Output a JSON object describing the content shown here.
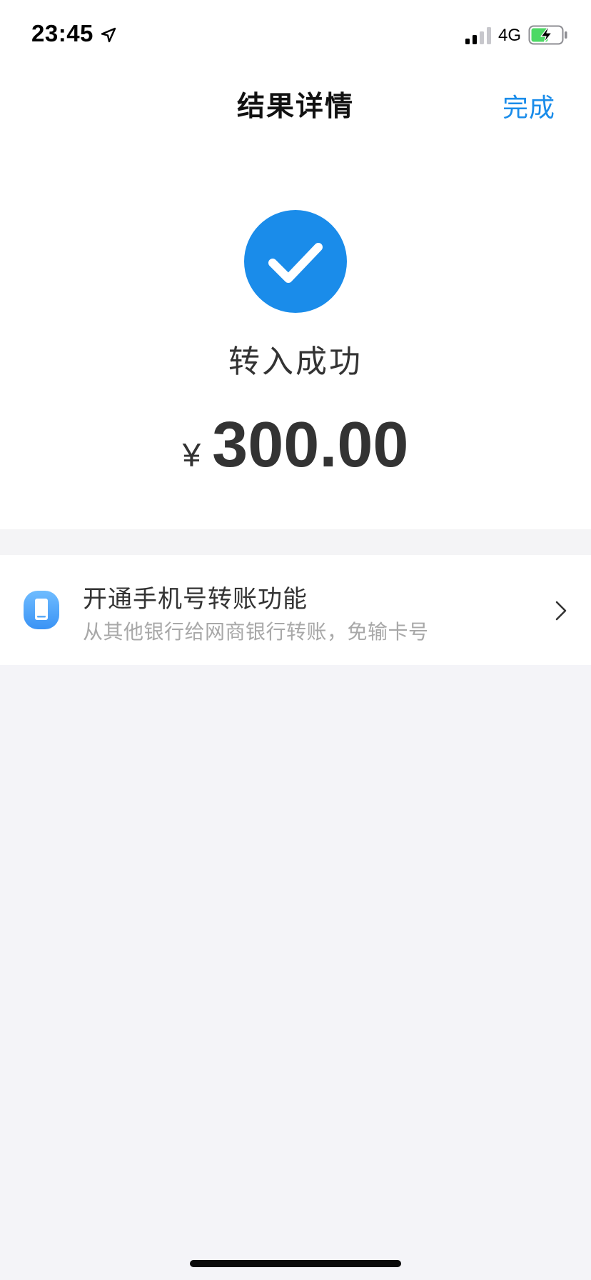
{
  "status_bar": {
    "time": "23:45",
    "network": "4G",
    "icons": {
      "location": "location-arrow-icon",
      "signal": "cellular-signal-icon",
      "battery": "battery-charging-icon"
    }
  },
  "nav": {
    "title": "结果详情",
    "done_label": "完成"
  },
  "result": {
    "status_text": "转入成功",
    "currency_symbol": "¥",
    "amount": "300.00"
  },
  "promo": {
    "icon": "phone-icon",
    "title": "开通手机号转账功能",
    "subtitle": "从其他银行给网商银行转账，免输卡号"
  },
  "colors": {
    "accent": "#1a8cea",
    "check_circle": "#1a8cea",
    "battery_green": "#4cd964",
    "page_background": "#f4f4f8"
  }
}
